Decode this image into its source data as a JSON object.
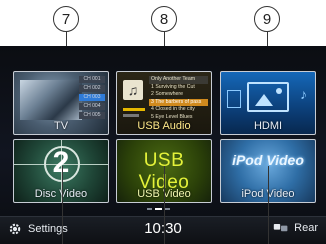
{
  "callouts": [
    "7",
    "8",
    "9"
  ],
  "tiles": [
    {
      "label": "TV"
    },
    {
      "label": "USB Audio"
    },
    {
      "label": "HDMI"
    },
    {
      "label": "Disc Video",
      "graphic_text": "2"
    },
    {
      "label": "USB Video",
      "graphic_text": "USB Video"
    },
    {
      "label": "iPod Video",
      "graphic_text": "iPod Video"
    }
  ],
  "tv_channel_list": [
    "CH 001",
    "CH 002",
    "CH 003",
    "CH 004",
    "CH 005"
  ],
  "usb_audio_tracks": [
    "Only Another Team",
    "1  Surviving the Cut",
    "2  Somewhere",
    "3  The barbers of pass",
    "4  Closed in the city",
    "5  Eye Level Blues"
  ],
  "status_bar": {
    "settings_label": "Settings",
    "clock": "10:30",
    "rear_label": "Rear"
  },
  "pagination": {
    "pages": 3,
    "current": 2
  },
  "colors": {
    "accent": "#6ad0ff",
    "usb_audio_highlight": "#d08a1e",
    "usb_video_text": "#e4f23a"
  },
  "icons": [
    "gear-icon",
    "rear-seat-icon",
    "music-note-icon",
    "picture-frame-icon"
  ]
}
